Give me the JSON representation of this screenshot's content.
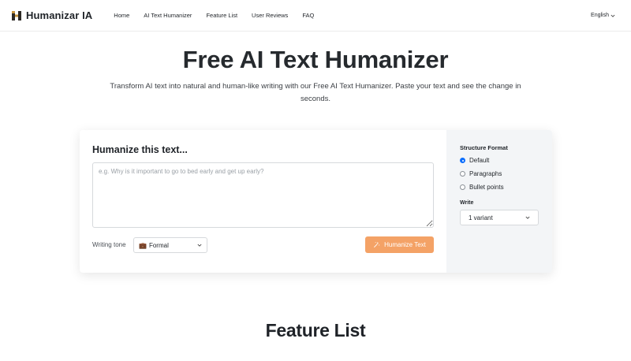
{
  "brand": {
    "name": "Humanizar IA",
    "logo_icon": "h-logo-icon",
    "logo_color": "#8a6a3a"
  },
  "nav": {
    "items": [
      {
        "label": "Home"
      },
      {
        "label": "AI Text Humanizer"
      },
      {
        "label": "Feature List"
      },
      {
        "label": "User Reviews"
      },
      {
        "label": "FAQ"
      }
    ],
    "language": "English"
  },
  "hero": {
    "title": "Free AI Text Humanizer",
    "subtitle": "Transform AI text into natural and human-like writing with our Free AI Text Humanizer. Paste your text and see the change in seconds."
  },
  "form": {
    "heading": "Humanize this text...",
    "textarea_placeholder": "e.g. Why is it important to go to bed early and get up early?",
    "tone_label": "Writing tone",
    "tone_value": "Formal",
    "tone_icon": "briefcase-emoji",
    "button_label": "Humanize Text",
    "button_color": "#f4a266"
  },
  "options": {
    "structure_title": "Structure Format",
    "structure_options": [
      {
        "label": "Default",
        "checked": true
      },
      {
        "label": "Paragraphs",
        "checked": false
      },
      {
        "label": "Bullet points",
        "checked": false
      }
    ],
    "write_label": "Write",
    "write_value": "1 variant"
  },
  "features": {
    "title": "Feature List"
  }
}
